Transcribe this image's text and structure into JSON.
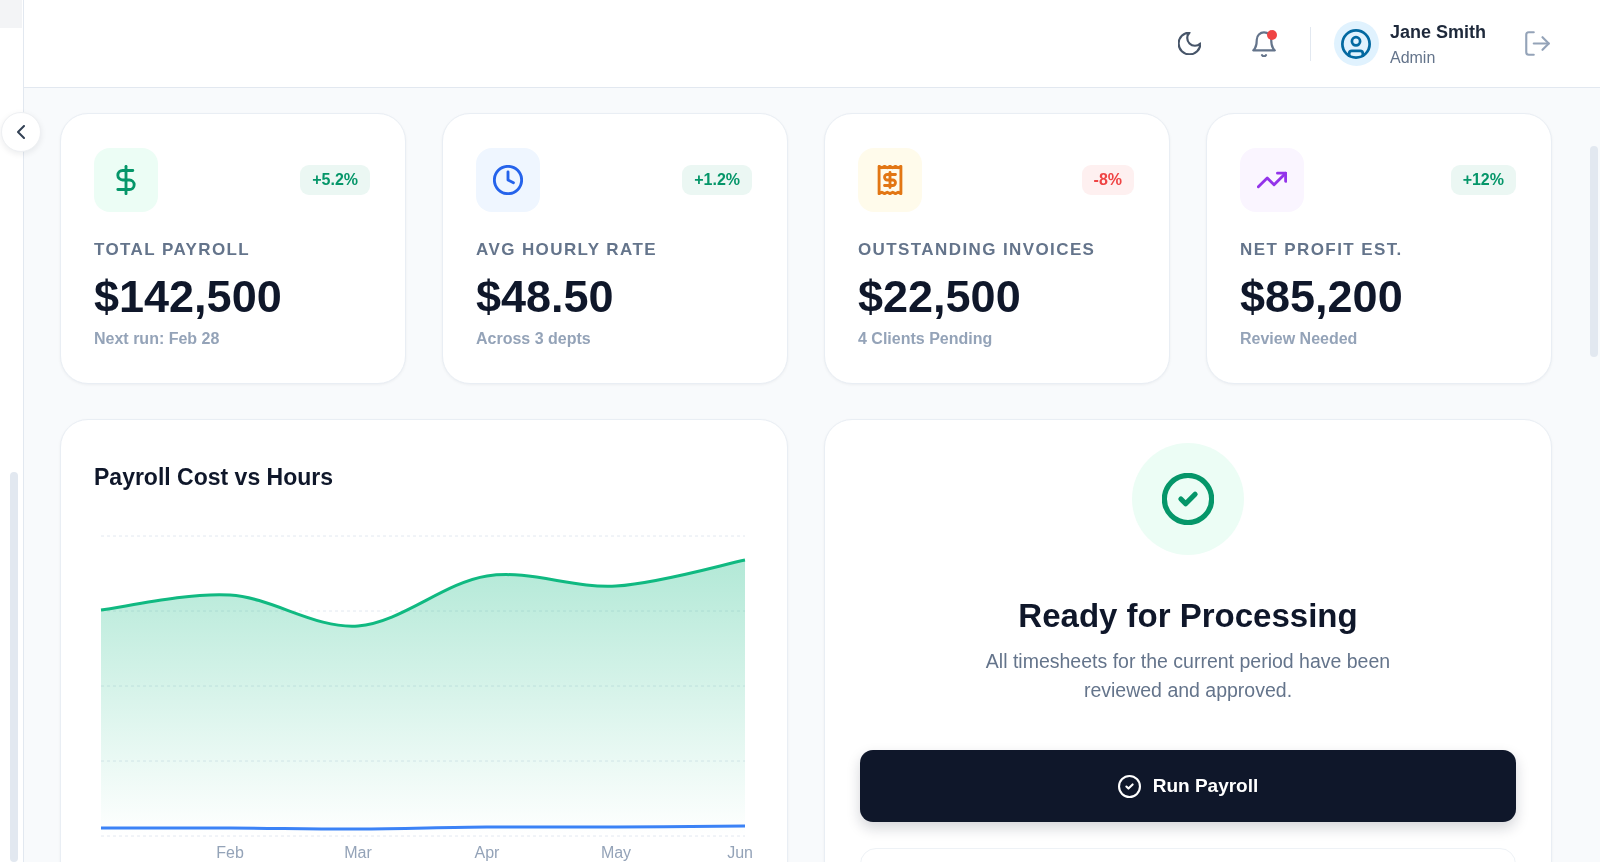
{
  "header": {
    "notifications": {
      "unread": true
    },
    "user": {
      "name": "Jane Smith",
      "role": "Admin"
    }
  },
  "cards": [
    {
      "label": "TOTAL PAYROLL",
      "value": "$142,500",
      "note": "Next run: Feb 28",
      "change": {
        "text": "+5.2%",
        "color": "#059669"
      }
    },
    {
      "label": "AVG HOURLY RATE",
      "value": "$48.50",
      "note": "Across 3 depts",
      "change": {
        "text": "+1.2%",
        "color": "#059669"
      }
    },
    {
      "label": "OUTSTANDING INVOICES",
      "value": "$22,500",
      "note": "4 Clients Pending",
      "change": {
        "text": "-8%",
        "color": "#ef4444"
      }
    },
    {
      "label": "NET PROFIT EST.",
      "value": "$85,200",
      "note": "Review Needed",
      "change": {
        "text": "+12%",
        "color": "#059669"
      }
    }
  ],
  "chart": {
    "title": "Payroll Cost vs Hours",
    "axis_labels": [
      "Feb",
      "Mar",
      "Apr",
      "May",
      "Jun"
    ]
  },
  "processing": {
    "title": "Ready for Processing",
    "description": "All timesheets for the current period have been reviewed and approved.",
    "button": "Run Payroll"
  }
}
